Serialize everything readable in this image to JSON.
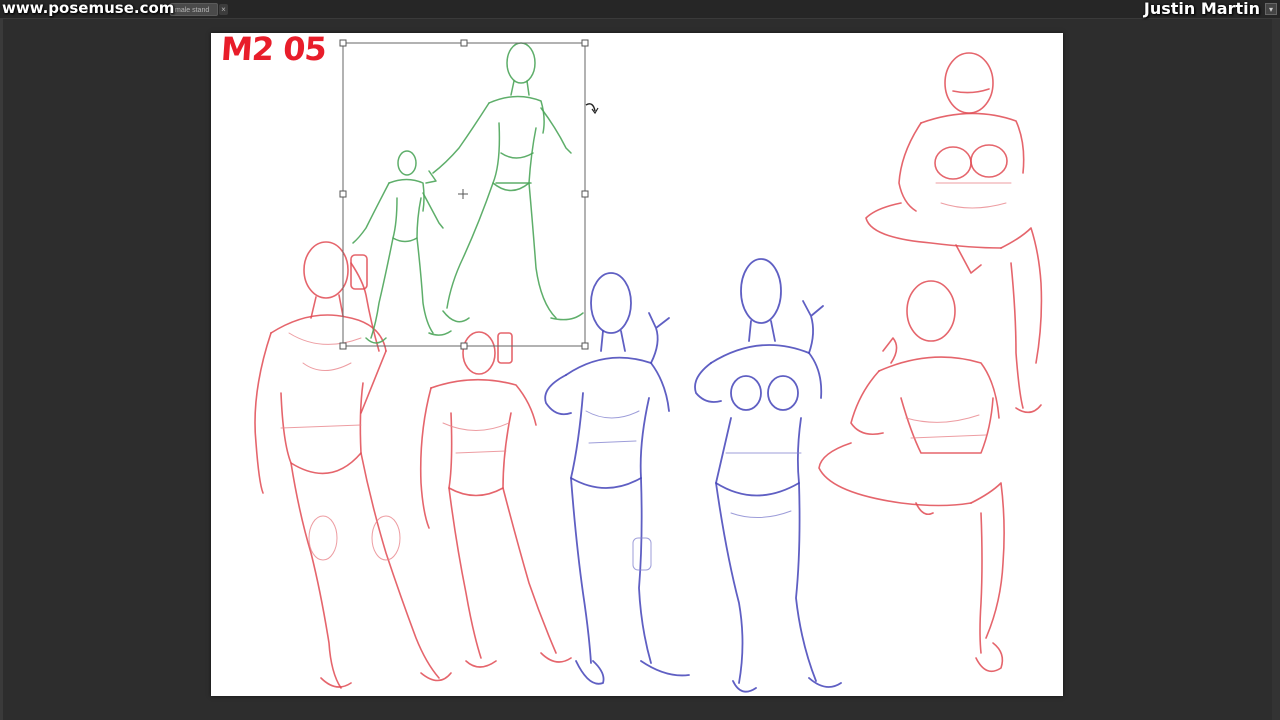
{
  "watermark": "www.posemuse.com",
  "document_tab": {
    "label": "male stand",
    "close_glyph": "×"
  },
  "author": "Justin Martin",
  "window_button_glyph": "▾",
  "page_label": "M2 05",
  "colors": {
    "app_background": "#2d2d2d",
    "canvas": "#ffffff",
    "sketch_red": "#e04a52",
    "sketch_blue": "#4343b8",
    "sketch_green": "#4da55a",
    "label_red": "#e81d2a"
  },
  "canvas": {
    "figures": [
      {
        "id": "walker-large",
        "color": "green",
        "selected": true
      },
      {
        "id": "walker-small",
        "color": "green",
        "selected": true
      },
      {
        "id": "male-selfie",
        "color": "red"
      },
      {
        "id": "phone-figure",
        "color": "red"
      },
      {
        "id": "peace-sign-figure",
        "color": "blue"
      },
      {
        "id": "peace-sign-female",
        "color": "blue"
      },
      {
        "id": "crouching-figure-top",
        "color": "red"
      },
      {
        "id": "crouching-figure-bottom",
        "color": "red"
      }
    ],
    "transform_box": {
      "active": true
    }
  }
}
